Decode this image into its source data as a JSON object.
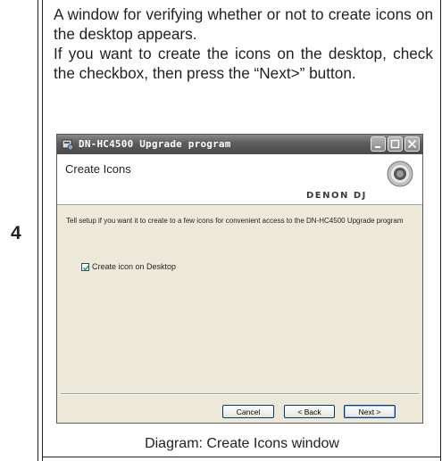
{
  "step": {
    "number": "4"
  },
  "instruction": {
    "line1": "A window for verifying whether or not to create icons on the desktop appears.",
    "line2": "If you want to create the icons on the desktop, check the checkbox, then press the “Next>” button."
  },
  "window": {
    "title": "DN-HC4500 Upgrade program",
    "header_title": "Create Icons",
    "brand": "DENON DJ",
    "description": "Tell setup if you want it to create to a few icons for convenient access to the DN-HC4500 Upgrade program",
    "checkbox": {
      "label": "Create icon on Desktop",
      "checked": true
    },
    "buttons": {
      "cancel": "Cancel",
      "back": "< Back",
      "next": "Next >"
    }
  },
  "caption": "Diagram: Create Icons window",
  "icons": [
    "app-icon",
    "minimize-icon",
    "maximize-icon",
    "close-icon",
    "denon-logo-ring-icon",
    "checkmark-icon"
  ]
}
